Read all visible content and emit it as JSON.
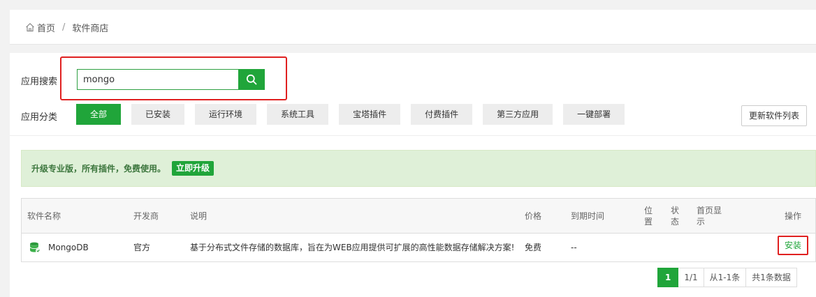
{
  "breadcrumb": {
    "home": "首页",
    "separator": "/",
    "current": "软件商店"
  },
  "search": {
    "label": "应用搜索",
    "value": "mongo",
    "placeholder": ""
  },
  "categories": {
    "label": "应用分类",
    "items": [
      "全部",
      "已安装",
      "运行环境",
      "系统工具",
      "宝塔插件",
      "付费插件",
      "第三方应用",
      "一键部署"
    ],
    "active_index": 0
  },
  "refresh_label": "更新软件列表",
  "upgrade": {
    "text": "升级专业版，所有插件，免费使用。",
    "button": "立即升级"
  },
  "table": {
    "headers": {
      "name": "软件名称",
      "developer": "开发商",
      "desc": "说明",
      "price": "价格",
      "expire": "到期时间",
      "position_a": "位",
      "position_b": "置",
      "status_a": "状",
      "status_b": "态",
      "home_a": "首页显",
      "home_b": "示",
      "action": "操作"
    },
    "rows": [
      {
        "name": "MongoDB",
        "developer": "官方",
        "desc": "基于分布式文件存储的数据库，旨在为WEB应用提供可扩展的高性能数据存储解决方案!",
        "price": "免费",
        "expire": "--",
        "action": "安装"
      }
    ]
  },
  "pager": {
    "current": "1",
    "pages": "1/1",
    "range": "从1-1条",
    "total": "共1条数据"
  },
  "colors": {
    "accent": "#20a53a",
    "highlight": "#e02020",
    "notice_bg": "#dff0d8"
  },
  "icons": {
    "home": "home-icon",
    "search": "search-icon",
    "database": "database-icon"
  }
}
